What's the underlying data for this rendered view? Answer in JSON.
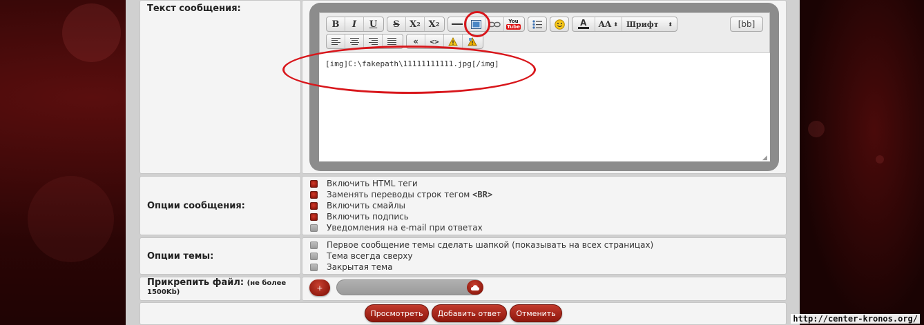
{
  "form": {
    "message_label": "Текст сообщения:",
    "message_options_label": "Опции сообщения:",
    "topic_options_label": "Опции темы:",
    "attach_label": "Прикрепить файл:",
    "attach_limit": "(не более 1500Kb)"
  },
  "toolbar": {
    "bold": "B",
    "italic": "I",
    "underline": "U",
    "strike": "S",
    "sup": "X",
    "sup_mark": "2",
    "sub": "X",
    "sub_mark": "2",
    "youtube_line1": "You",
    "youtube_line2": "Tube",
    "font_size": "AA",
    "font": "Шрифт",
    "bb_mode": "[bb]"
  },
  "editor": {
    "content": "[img]C:\\fakepath\\11111111111.jpg[/img]"
  },
  "message_options": [
    {
      "label": "Включить HTML теги",
      "checked": true
    },
    {
      "label": "Заменять переводы строк тегом <BR>",
      "checked": true
    },
    {
      "label": "Включить смайлы",
      "checked": true
    },
    {
      "label": "Включить подпись",
      "checked": true
    },
    {
      "label": "Уведомления на e-mail при ответах",
      "checked": false
    }
  ],
  "topic_options": [
    {
      "label": "Первое сообщение темы сделать шапкой (показывать на всех страницах)",
      "checked": false
    },
    {
      "label": "Тема всегда сверху",
      "checked": false
    },
    {
      "label": "Закрытая тема",
      "checked": false
    }
  ],
  "attach": {
    "plus": "+"
  },
  "actions": {
    "preview": "Просмотреть",
    "submit": "Добавить ответ",
    "cancel": "Отменить"
  },
  "watermark": "http://center-kronos.org/",
  "colors": {
    "accent": "#a0231a",
    "annotation": "#d8161b",
    "panel": "#d0d0d0",
    "cell": "#f4f4f4"
  }
}
